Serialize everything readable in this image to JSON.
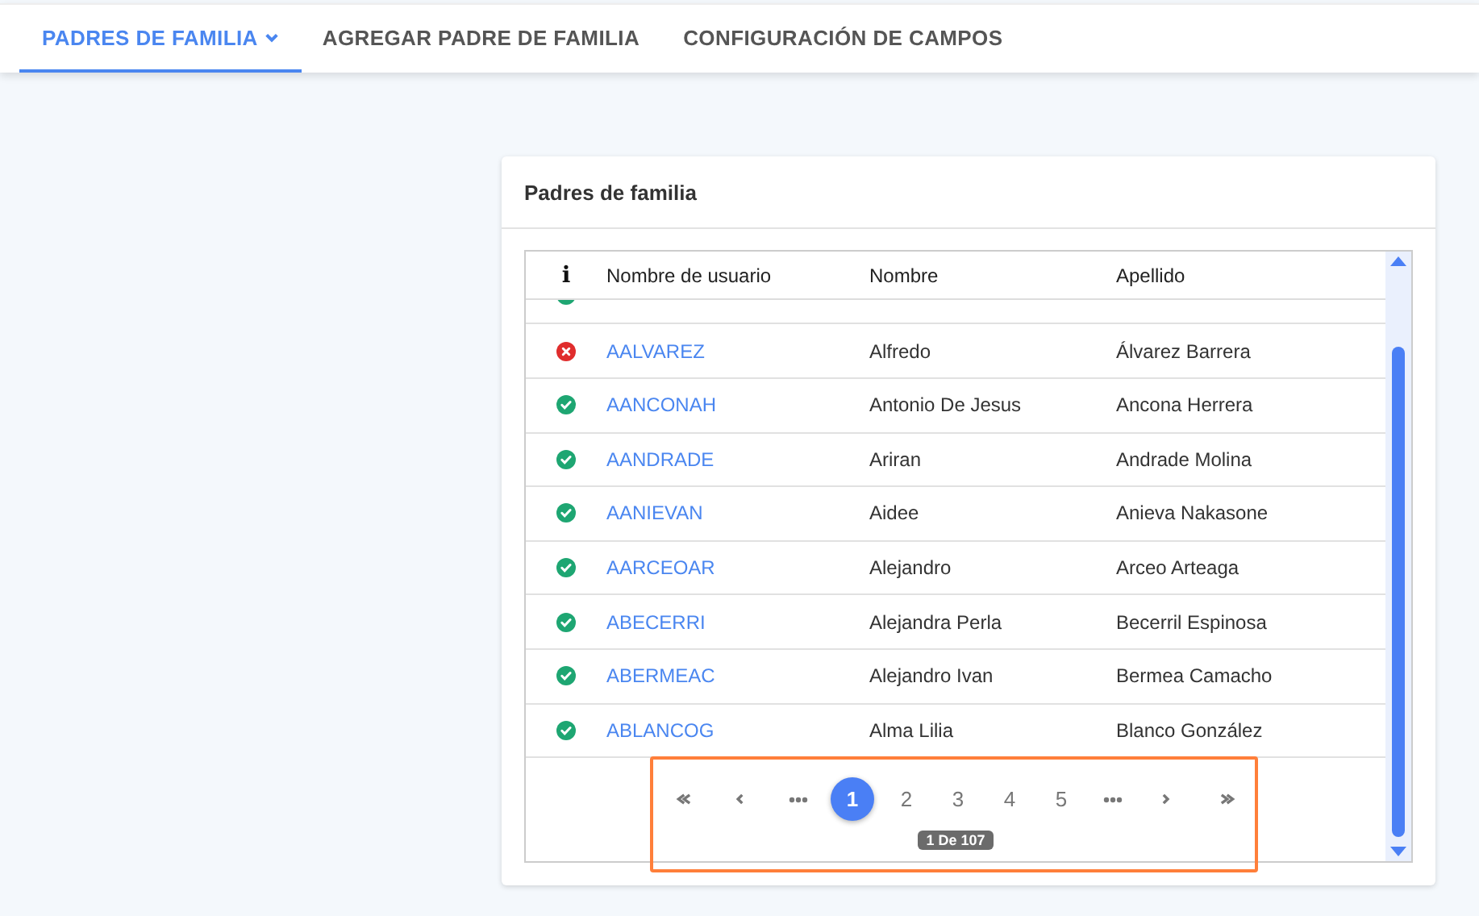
{
  "tabs": [
    {
      "label": "PADRES DE FAMILIA",
      "selected": true,
      "dropdown": true
    },
    {
      "label": "AGREGAR PADRE DE FAMILIA",
      "selected": false,
      "dropdown": false
    },
    {
      "label": "CONFIGURACIÓN DE CAMPOS",
      "selected": false,
      "dropdown": false
    }
  ],
  "card": {
    "title": "Padres de familia",
    "table": {
      "columns": [
        "i",
        "Nombre de usuario",
        "Nombre",
        "Apellido"
      ],
      "partial_row": {
        "ok": true
      },
      "rows": [
        {
          "ok": false,
          "username": "AALVAREZ",
          "nombre": "Alfredo",
          "apellido": "Álvarez Barrera"
        },
        {
          "ok": true,
          "username": "AANCONAH",
          "nombre": "Antonio De Jesus",
          "apellido": "Ancona Herrera"
        },
        {
          "ok": true,
          "username": "AANDRADE",
          "nombre": "Ariran",
          "apellido": "Andrade Molina"
        },
        {
          "ok": true,
          "username": "AANIEVAN",
          "nombre": "Aidee",
          "apellido": "Anieva Nakasone"
        },
        {
          "ok": true,
          "username": "AARCEOAR",
          "nombre": "Alejandro",
          "apellido": "Arceo Arteaga"
        },
        {
          "ok": true,
          "username": "ABECERRI",
          "nombre": "Alejandra Perla",
          "apellido": "Becerril Espinosa"
        },
        {
          "ok": true,
          "username": "ABERMEAC",
          "nombre": "Alejandro Ivan",
          "apellido": "Bermea Camacho"
        },
        {
          "ok": true,
          "username": "ABLANCOG",
          "nombre": "Alma Lilia",
          "apellido": "Blanco González"
        }
      ]
    },
    "pagination": {
      "highlighted": true,
      "pages": [
        {
          "kind": "first"
        },
        {
          "kind": "prev"
        },
        {
          "kind": "ellipsis"
        },
        {
          "kind": "page",
          "label": "1",
          "selected": true
        },
        {
          "kind": "page",
          "label": "2",
          "selected": false
        },
        {
          "kind": "page",
          "label": "3",
          "selected": false
        },
        {
          "kind": "page",
          "label": "4",
          "selected": false
        },
        {
          "kind": "page",
          "label": "5",
          "selected": false
        },
        {
          "kind": "ellipsis"
        },
        {
          "kind": "next"
        },
        {
          "kind": "last"
        }
      ],
      "summary": "1 De 107"
    }
  }
}
